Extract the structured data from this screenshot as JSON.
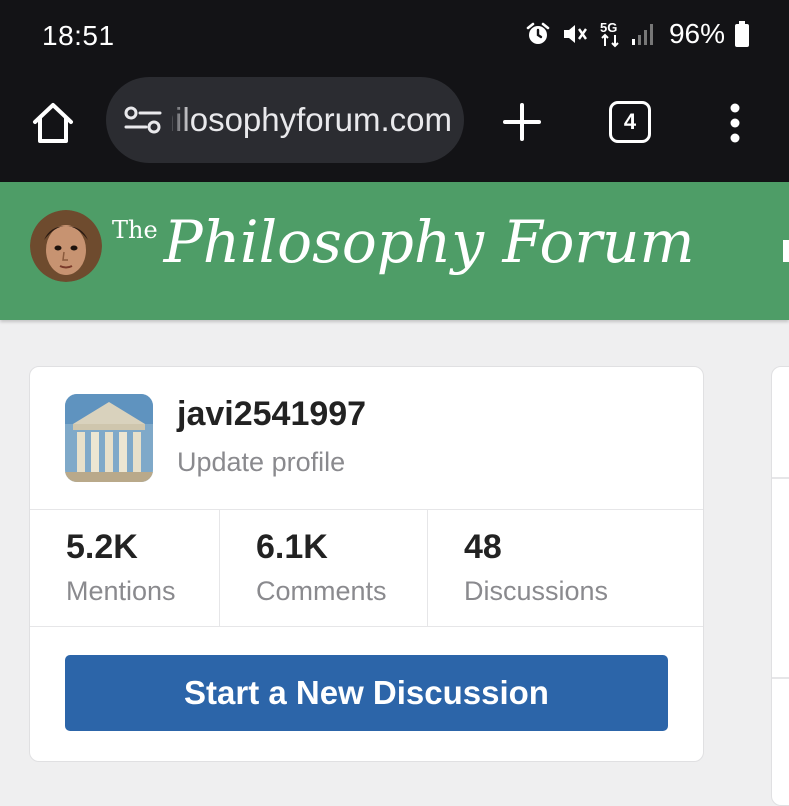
{
  "status_bar": {
    "time": "18:51",
    "battery_percent": "96%",
    "icons": [
      "alarm-icon",
      "mute-icon",
      "5g-icon",
      "signal-icon",
      "battery-icon"
    ],
    "network_label": "5G"
  },
  "browser": {
    "url": "philosophyforum.com",
    "tab_count": "4",
    "icons": [
      "home-icon",
      "site-settings-icon",
      "plus-icon",
      "tab-switcher-icon",
      "more-vert-icon"
    ]
  },
  "site": {
    "title_prefix": "The",
    "title": "Philosophy Forum",
    "header_color": "#4e9d67"
  },
  "profile": {
    "username": "javi2541997",
    "update_label": "Update profile",
    "stats": [
      {
        "value": "5.2K",
        "label": "Mentions"
      },
      {
        "value": "6.1K",
        "label": "Comments"
      },
      {
        "value": "48",
        "label": "Discussions"
      }
    ],
    "new_discussion_label": "Start a New Discussion",
    "button_color": "#2c65a9"
  }
}
